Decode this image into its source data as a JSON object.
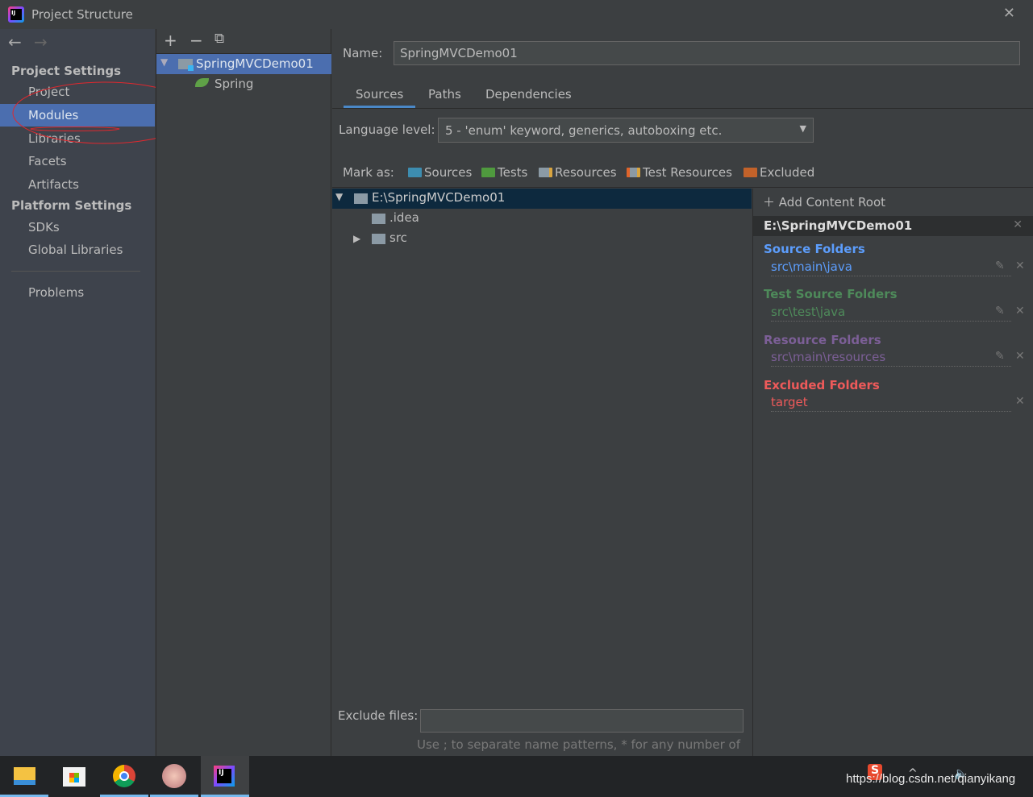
{
  "window": {
    "title": "Project Structure",
    "close": "✕",
    "logo_text": "IJ"
  },
  "nav": {
    "back": "←",
    "forward": "→",
    "project_settings": "Project Settings",
    "items": [
      "Project",
      "Modules",
      "Libraries",
      "Facets",
      "Artifacts"
    ],
    "platform_settings": "Platform Settings",
    "platform_items": [
      "SDKs",
      "Global Libraries"
    ],
    "problems": "Problems",
    "selected": "Modules"
  },
  "module_tree": {
    "toolbar": {
      "add": "+",
      "remove": "−",
      "copy": "⧉"
    },
    "module": "SpringMVCDemo01",
    "facet": "Spring"
  },
  "main": {
    "name_label": "Name:",
    "name_value": "SpringMVCDemo01",
    "tabs": [
      "Sources",
      "Paths",
      "Dependencies"
    ],
    "active_tab": "Sources",
    "language_label": "Language level:",
    "language_value": "5 - 'enum' keyword, generics, autoboxing etc.",
    "mark_as_label": "Mark as:",
    "mark_as": [
      {
        "label": "Sources",
        "color": "#3d8db0"
      },
      {
        "label": "Tests",
        "color": "#4f9a3e"
      },
      {
        "label": "Resources",
        "color": "#8b9aa5"
      },
      {
        "label": "Test Resources",
        "color": "#8b9aa5"
      },
      {
        "label": "Excluded",
        "color": "#c2622a"
      }
    ],
    "tree": {
      "root": "E:\\SpringMVCDemo01",
      "children": [
        ".idea",
        "src"
      ]
    },
    "exclude_label": "Exclude files:",
    "exclude_value": "",
    "exclude_hint": "Use ; to separate name patterns, * for any number of"
  },
  "roots": {
    "add": "Add Content Root",
    "root": "E:\\SpringMVCDemo01",
    "groups": [
      {
        "title": "Source Folders",
        "item": "src\\main\\java",
        "color": "#5c9dfc"
      },
      {
        "title": "Test Source Folders",
        "item": "src\\test\\java",
        "color": "#4e8a5a"
      },
      {
        "title": "Resource Folders",
        "item": "src\\main\\resources",
        "color": "#7c5f97"
      },
      {
        "title": "Excluded Folders",
        "item": "target",
        "color": "#ee5a5a"
      }
    ]
  },
  "taskbar": {
    "apps": [
      "file-explorer",
      "microsoft-store",
      "chrome",
      "avatar-app",
      "intellij-idea"
    ],
    "watermark": "https://blog.csdn.net/qianyikang"
  },
  "colors": {
    "selection": "#4b6eaf",
    "tree_selection": "#0d293e",
    "annotation": "#e0282e"
  }
}
